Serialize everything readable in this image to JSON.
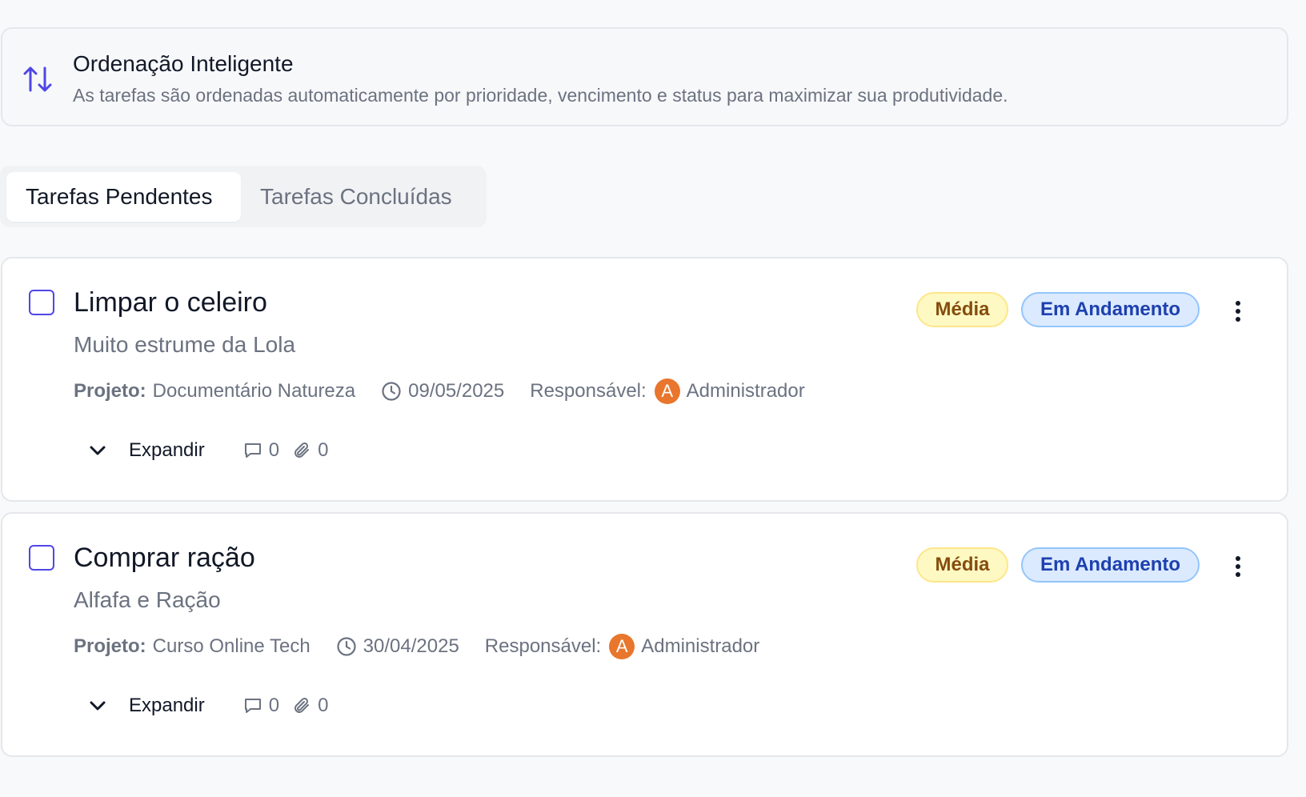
{
  "info_banner": {
    "icon": "sort-arrows-icon",
    "title": "Ordenação Inteligente",
    "description": "As tarefas são ordenadas automaticamente por prioridade, vencimento e status para maximizar sua produtividade."
  },
  "tabs": [
    {
      "label": "Tarefas Pendentes",
      "active": true
    },
    {
      "label": "Tarefas Concluídas",
      "active": false
    }
  ],
  "tasks": [
    {
      "title": "Limpar o celeiro",
      "description": "Muito estrume da Lola",
      "priority": "Média",
      "status": "Em Andamento",
      "project_label": "Projeto:",
      "project": "Documentário Natureza",
      "due_date": "09/05/2025",
      "assignee_label": "Responsável:",
      "assignee_initial": "A",
      "assignee": "Administrador",
      "expand_label": "Expandir",
      "comments": "0",
      "attachments": "0"
    },
    {
      "title": "Comprar ração",
      "description": "Alfafa e Ração",
      "priority": "Média",
      "status": "Em Andamento",
      "project_label": "Projeto:",
      "project": "Curso Online Tech",
      "due_date": "30/04/2025",
      "assignee_label": "Responsável:",
      "assignee_initial": "A",
      "assignee": "Administrador",
      "expand_label": "Expandir",
      "comments": "0",
      "attachments": "0"
    }
  ],
  "colors": {
    "accent": "#4f46e5",
    "priority_bg": "#fef9c3",
    "priority_text": "#854d0e",
    "status_bg": "#dbeafe",
    "status_text": "#1e40af",
    "avatar": "#e8762c"
  }
}
